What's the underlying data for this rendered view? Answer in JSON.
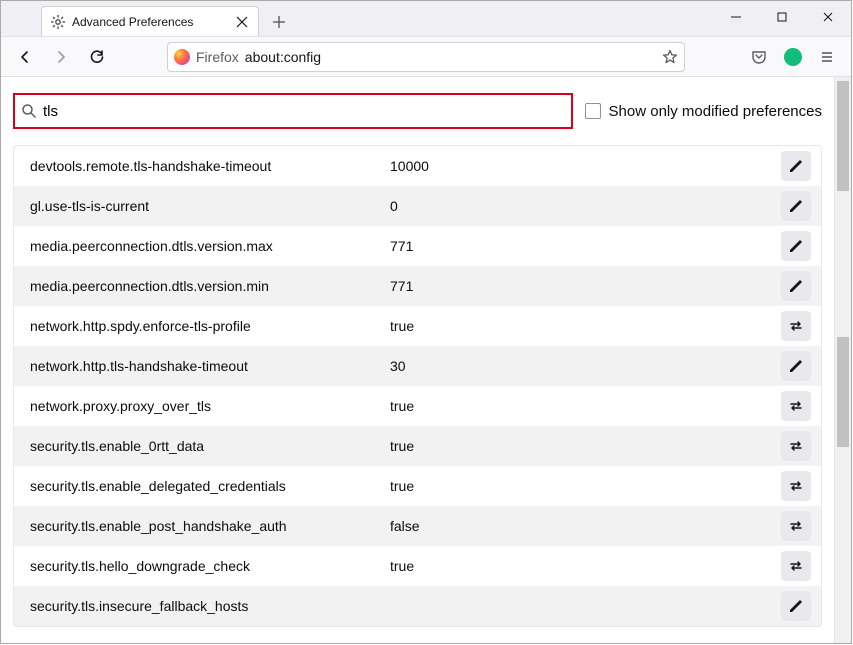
{
  "window": {
    "tab_title": "Advanced Preferences",
    "url_protocol_label": "Firefox",
    "url_address": "about:config"
  },
  "search": {
    "value": "tls",
    "show_modified_label": "Show only modified preferences",
    "show_modified_checked": false
  },
  "prefs": [
    {
      "name": "devtools.remote.tls-handshake-timeout",
      "value": "10000",
      "action": "edit"
    },
    {
      "name": "gl.use-tls-is-current",
      "value": "0",
      "action": "edit"
    },
    {
      "name": "media.peerconnection.dtls.version.max",
      "value": "771",
      "action": "edit"
    },
    {
      "name": "media.peerconnection.dtls.version.min",
      "value": "771",
      "action": "edit"
    },
    {
      "name": "network.http.spdy.enforce-tls-profile",
      "value": "true",
      "action": "toggle"
    },
    {
      "name": "network.http.tls-handshake-timeout",
      "value": "30",
      "action": "edit"
    },
    {
      "name": "network.proxy.proxy_over_tls",
      "value": "true",
      "action": "toggle"
    },
    {
      "name": "security.tls.enable_0rtt_data",
      "value": "true",
      "action": "toggle"
    },
    {
      "name": "security.tls.enable_delegated_credentials",
      "value": "true",
      "action": "toggle"
    },
    {
      "name": "security.tls.enable_post_handshake_auth",
      "value": "false",
      "action": "toggle"
    },
    {
      "name": "security.tls.hello_downgrade_check",
      "value": "true",
      "action": "toggle"
    },
    {
      "name": "security.tls.insecure_fallback_hosts",
      "value": "",
      "action": "edit"
    }
  ]
}
